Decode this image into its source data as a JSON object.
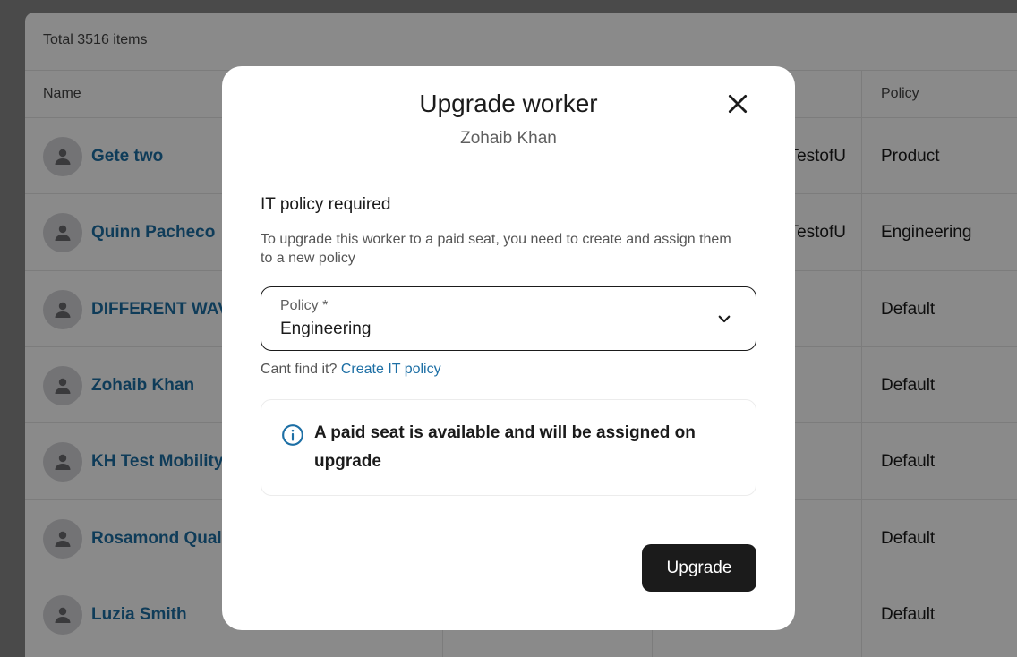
{
  "table": {
    "total_label": "Total 3516 items",
    "columns": {
      "name": "Name",
      "policy": "Policy"
    },
    "rows": [
      {
        "name": "Gete two",
        "extra": "nTestofU",
        "policy": "Product"
      },
      {
        "name": "Quinn Pacheco",
        "extra": "nTestofU",
        "policy": "Engineering"
      },
      {
        "name": "DIFFERENT WAV",
        "extra": "",
        "policy": "Default"
      },
      {
        "name": "Zohaib Khan",
        "extra": "",
        "policy": "Default"
      },
      {
        "name": "KH Test Mobility",
        "extra": "",
        "policy": "Default"
      },
      {
        "name": "Rosamond Quali",
        "extra": "",
        "policy": "Default"
      },
      {
        "name": "Luzia Smith",
        "extra": "",
        "policy": "Default"
      }
    ]
  },
  "modal": {
    "title": "Upgrade worker",
    "subtitle": "Zohaib Khan",
    "section_title": "IT policy required",
    "description": "To upgrade this worker to a paid seat, you need to create and assign them to a new policy",
    "policy_select": {
      "label": "Policy *",
      "value": "Engineering"
    },
    "help_text": "Cant find it?",
    "help_link": "Create IT policy",
    "info_message": "A paid seat is available and will be assigned on upgrade",
    "upgrade_button": "Upgrade"
  },
  "icons": {
    "close": "close-icon",
    "chevron": "chevron-down-icon",
    "info": "info-icon",
    "avatar": "user-icon"
  },
  "colors": {
    "link": "#1d6fa5",
    "button_bg": "#1b1b1b",
    "avatar_bg": "#d4d4d8"
  }
}
